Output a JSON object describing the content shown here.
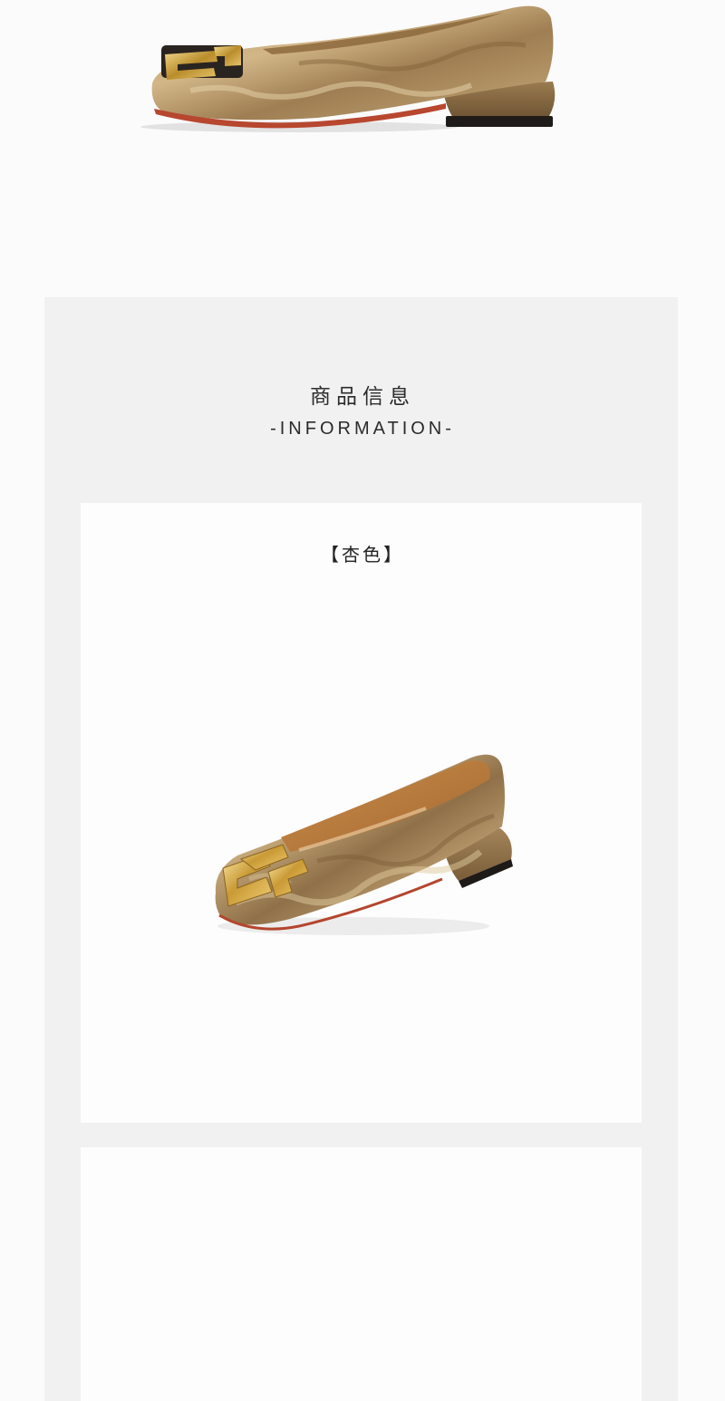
{
  "section": {
    "title": "商品信息",
    "subtitle": "-INFORMATION-"
  },
  "product": {
    "color_label": "【杏色】"
  },
  "colors": {
    "page_bg": "#fbfbfb",
    "panel_bg": "#f1f1f1",
    "card_bg": "#fdfdfd",
    "satin_dark": "#9c7c50",
    "satin_light": "#c8ab7e",
    "buckle_gold": "#c9a03a",
    "heel_taupe": "#8b6d45"
  }
}
